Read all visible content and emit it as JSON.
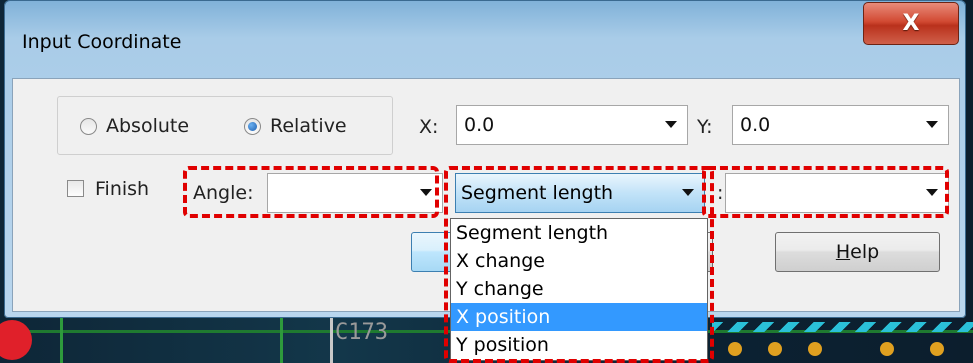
{
  "window": {
    "title": "Input Coordinate",
    "close_label": "X"
  },
  "mode": {
    "absolute_label": "Absolute",
    "relative_label": "Relative",
    "selected": "Relative"
  },
  "x_field": {
    "label": "X:",
    "value": "0.0"
  },
  "y_field": {
    "label": "Y:",
    "value": "0.0"
  },
  "finish": {
    "label": "Finish",
    "checked": false
  },
  "angle_field": {
    "label": "Angle:",
    "value": ""
  },
  "segment_combo": {
    "selected": "Segment length",
    "options": [
      "Segment length",
      "X change",
      "Y change",
      "X position",
      "Y position"
    ],
    "highlighted": "X position"
  },
  "segment_value": {
    "label": ":",
    "value": ""
  },
  "help_button": {
    "label_prefix": "",
    "label_underlined": "H",
    "label_rest": "elp"
  },
  "background": {
    "pcb_label": "C173"
  },
  "colors": {
    "highlight_border": "#e00000",
    "selection": "#3399ff"
  }
}
